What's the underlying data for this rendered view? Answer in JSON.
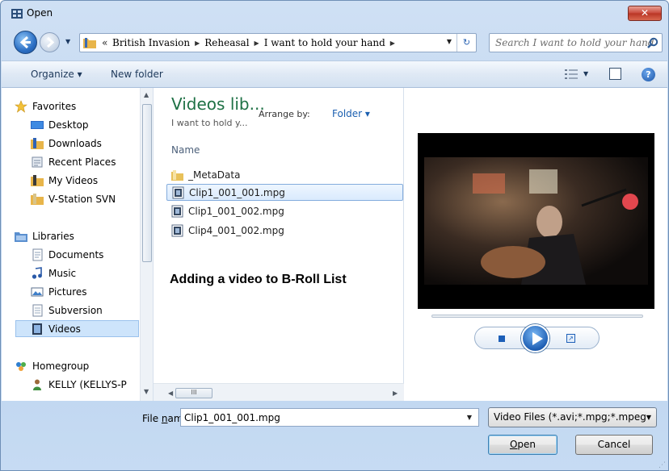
{
  "window": {
    "title": "Open",
    "close_label": "✕"
  },
  "address": {
    "prefix": "«",
    "breadcrumbs": [
      "British Invasion",
      "Reheasal",
      "I want to hold your hand"
    ],
    "search_placeholder": "Search I want to hold your hand"
  },
  "toolbar": {
    "organize_label": "Organize ▾",
    "new_folder_label": "New folder",
    "help_label": "?"
  },
  "nav": {
    "favorites_label": "Favorites",
    "favorites": [
      "Desktop",
      "Downloads",
      "Recent Places",
      "My Videos",
      "V-Station SVN"
    ],
    "libraries_label": "Libraries",
    "libraries": [
      "Documents",
      "Music",
      "Pictures",
      "Subversion",
      "Videos"
    ],
    "selected": "Videos",
    "homegroup_label": "Homegroup",
    "homegroup_user": "KELLY (KELLYS-P"
  },
  "files": {
    "library_title": "Videos lib...",
    "library_subtitle": "I want to hold y...",
    "arrange_label": "Arrange by:",
    "arrange_value": "Folder ▾",
    "column_name": "Name",
    "items": [
      "_MetaData",
      "Clip1_001_001.mpg",
      "Clip1_001_002.mpg",
      "Clip4_001_002.mpg"
    ],
    "selected_index": 1,
    "caption": "Adding a video to B-Roll List",
    "hscroll_grip": "III"
  },
  "footer": {
    "file_name_label_u": "n",
    "file_name_label_pre": "File ",
    "file_name_label_post": "ame:",
    "file_name_value": "Clip1_001_001.mpg",
    "filter_value": "Video Files (*.avi;*.mpg;*.mpeg",
    "open_label_u": "O",
    "open_label_rest": "pen",
    "cancel_label": "Cancel"
  },
  "colors": {
    "accent": "#1e7145",
    "selection": "#cde4fb",
    "link": "#1b5fb0"
  }
}
